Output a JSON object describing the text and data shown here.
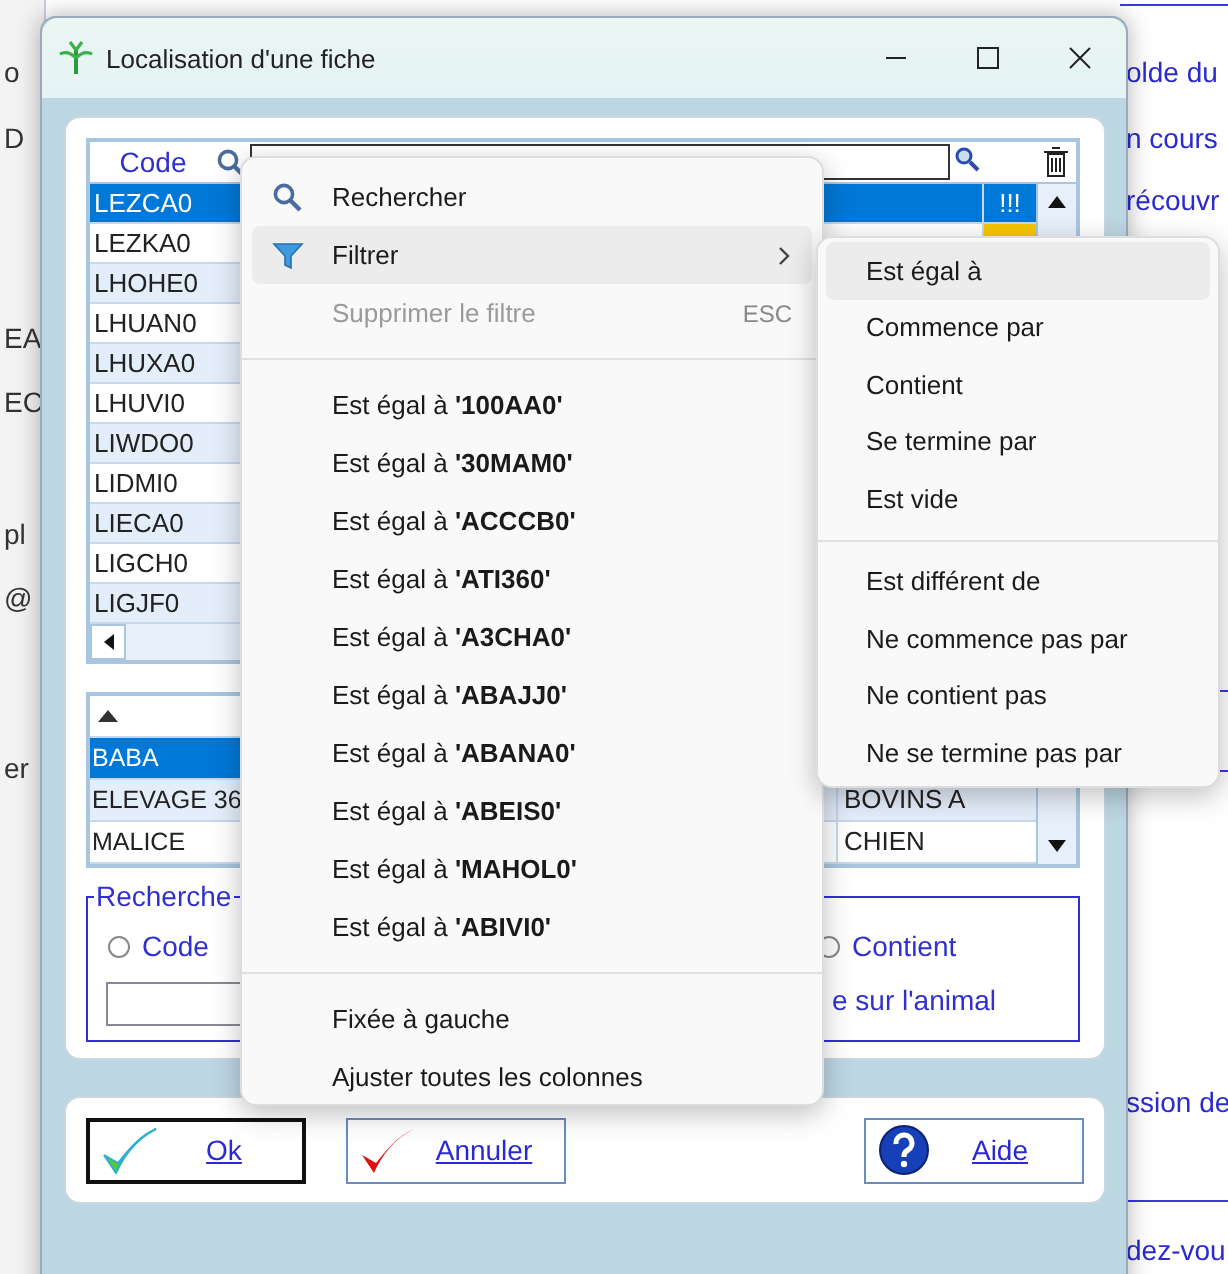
{
  "background": {
    "left_texts": [
      "o",
      "D",
      "EA",
      "EC",
      "pl",
      "@",
      "er"
    ],
    "right_texts": [
      "olde du",
      "n cours",
      "récouvr",
      "ssion de",
      "dez-vou"
    ]
  },
  "window": {
    "title": "Localisation d'une fiche"
  },
  "grid": {
    "column_header": "Code",
    "rows": [
      {
        "code": "LEZCA0",
        "selected": true,
        "marked": false,
        "flag": "!!!"
      },
      {
        "code": "LEZKA0",
        "selected": false,
        "marked": true
      },
      {
        "code": "LHOHE0",
        "selected": false
      },
      {
        "code": "LHUAN0",
        "selected": false
      },
      {
        "code": "LHUXA0",
        "selected": false
      },
      {
        "code": "LHUVI0",
        "selected": false
      },
      {
        "code": "LIWDO0",
        "selected": false
      },
      {
        "code": "LIDMI0",
        "selected": false
      },
      {
        "code": "LIECA0",
        "selected": false
      },
      {
        "code": "LIGCH0",
        "selected": false
      },
      {
        "code": "LIGJF0",
        "selected": false
      }
    ]
  },
  "animals": {
    "rows": [
      {
        "name": "BABA",
        "selected": true
      },
      {
        "name": "ELEVAGE 36",
        "type": "BOVINS A",
        "selected": false
      },
      {
        "name": "MALICE",
        "type": "CHIEN",
        "selected": false
      }
    ]
  },
  "search_group": {
    "legend": "Recherche",
    "options": [
      {
        "label": "Code",
        "selected": false
      },
      {
        "label": "Contient",
        "selected": false
      }
    ],
    "hint": "e sur l'animal"
  },
  "buttons": [
    {
      "label": "Ok",
      "kind": "ok",
      "focused": true
    },
    {
      "label": "Annuler",
      "kind": "cancel",
      "focused": false
    },
    {
      "label": "Aide",
      "kind": "help",
      "focused": false
    }
  ],
  "context_menu": {
    "items": [
      {
        "kind": "search",
        "label": "Rechercher",
        "selected": false,
        "disabled": false
      },
      {
        "kind": "filter",
        "label": "Filtrer",
        "selected": true,
        "disabled": false
      },
      {
        "kind": "item",
        "label": "Supprimer le filtre",
        "shortcut": "ESC",
        "selected": false,
        "disabled": true
      },
      {
        "kind": "separator"
      },
      {
        "kind": "item",
        "label": "Est égal à **'100AA0'**",
        "selected": false,
        "disabled": false
      },
      {
        "kind": "item",
        "label": "Est égal à **'30MAM0'**",
        "selected": false,
        "disabled": false
      },
      {
        "kind": "item",
        "label": "Est égal à **'ACCCB0'**",
        "selected": false,
        "disabled": false
      },
      {
        "kind": "item",
        "label": "Est égal à **'ATI360'**",
        "selected": false,
        "disabled": false
      },
      {
        "kind": "item",
        "label": "Est égal à **'A3CHA0'**",
        "selected": false,
        "disabled": false
      },
      {
        "kind": "item",
        "label": "Est égal à **'ABAJJ0'**",
        "selected": false,
        "disabled": false
      },
      {
        "kind": "item",
        "label": "Est égal à **'ABANA0'**",
        "selected": false,
        "disabled": false
      },
      {
        "kind": "item",
        "label": "Est égal à **'ABEIS0'**",
        "selected": false,
        "disabled": false
      },
      {
        "kind": "item",
        "label": "Est égal à **'MAHOL0'**",
        "selected": false,
        "disabled": false
      },
      {
        "kind": "item",
        "label": "Est égal à **'ABIVI0'**",
        "selected": false,
        "disabled": false
      },
      {
        "kind": "separator"
      },
      {
        "kind": "item",
        "label": "Fixée à gauche",
        "selected": false,
        "disabled": false
      },
      {
        "kind": "item",
        "label": "Ajuster toutes les colonnes",
        "selected": false,
        "disabled": false
      }
    ]
  },
  "submenu": {
    "items": [
      {
        "kind": "item",
        "label": "Est égal à",
        "selected": true
      },
      {
        "kind": "item",
        "label": "Commence par",
        "selected": false
      },
      {
        "kind": "item",
        "label": "Contient",
        "selected": false
      },
      {
        "kind": "item",
        "label": "Se termine par",
        "selected": false
      },
      {
        "kind": "item",
        "label": "Est vide",
        "selected": false
      },
      {
        "kind": "separator"
      },
      {
        "kind": "item",
        "label": "Est différent de",
        "selected": false
      },
      {
        "kind": "item",
        "label": "Ne commence pas par",
        "selected": false
      },
      {
        "kind": "item",
        "label": "Ne contient pas",
        "selected": false
      },
      {
        "kind": "item",
        "label": "Ne se termine pas par",
        "selected": false
      }
    ]
  }
}
